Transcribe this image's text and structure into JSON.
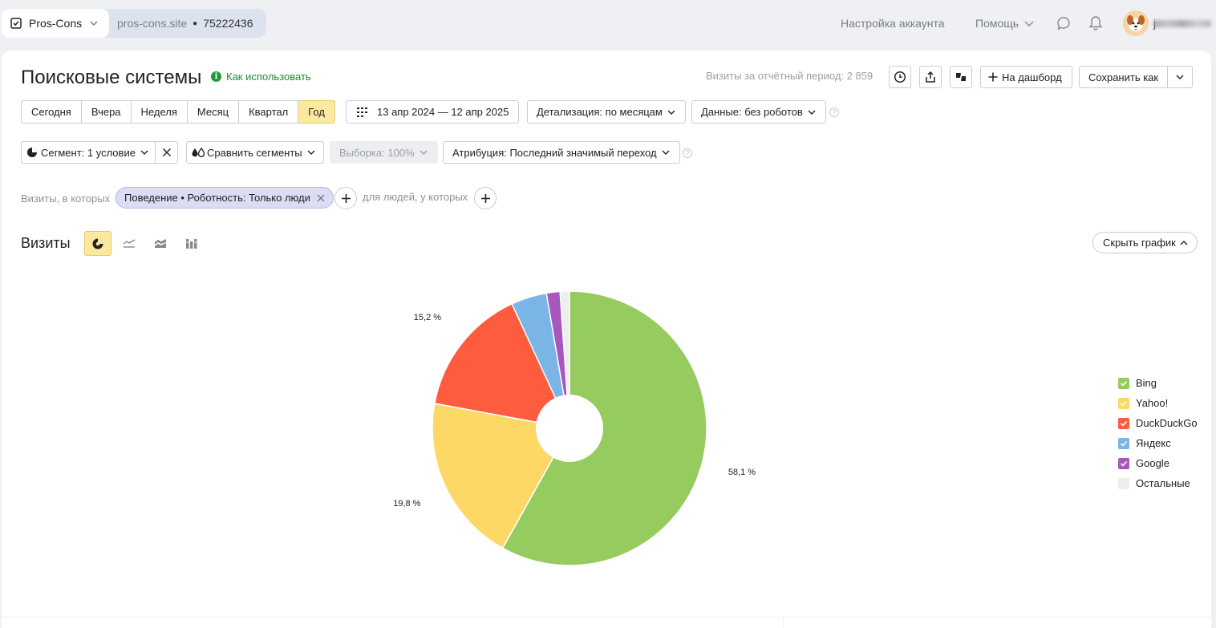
{
  "topbar": {
    "app_name": "Pros-Cons",
    "site_domain": "pros-cons.site",
    "counter_id": "75222436",
    "account_settings": "Настройка аккаунта",
    "help": "Помощь",
    "username": "j"
  },
  "header": {
    "title": "Поисковые системы",
    "how_to_use": "Как использовать",
    "visits_total": "Визиты за отчётный период: 2 859",
    "to_dashboard": "На дашборд",
    "save_as": "Сохранить как"
  },
  "periods": {
    "items": [
      "Сегодня",
      "Вчера",
      "Неделя",
      "Месяц",
      "Квартал",
      "Год"
    ],
    "active": "Год"
  },
  "toolbar": {
    "date_range": "13 апр 2024 — 12 апр 2025",
    "detail": "Детализация: по месяцам",
    "data": "Данные: без роботов",
    "segment": "Сегмент: 1 условие",
    "compare": "Сравнить сегменты",
    "sample": "Выборка: 100%",
    "attribution": "Атрибуция: Последний значимый переход"
  },
  "filters": {
    "visits_label": "Визиты, в которых",
    "chip_text": "Поведение • Роботность: Только люди",
    "people_label": "для людей, у которых"
  },
  "chart_header": {
    "title": "Визиты",
    "hide_chart": "Скрыть график"
  },
  "colors": {
    "accent_active": "#fde8a0",
    "link_green": "#208a32"
  },
  "chart_data": {
    "type": "pie",
    "donut": true,
    "title": "",
    "categories": [
      "Bing",
      "Yahoo!",
      "DuckDuckGo",
      "Яндекс",
      "Google",
      "Остальные"
    ],
    "values": [
      58.1,
      19.8,
      15.2,
      4.2,
      1.6,
      1.1
    ],
    "value_labels": [
      "58,1 %",
      "19,8 %",
      "15,2 %",
      "",
      "",
      ""
    ],
    "colors": [
      "#96cb60",
      "#fdd866",
      "#fd5c3f",
      "#7ab5e6",
      "#a857be",
      "#eeeeee"
    ],
    "legend_position": "right"
  }
}
